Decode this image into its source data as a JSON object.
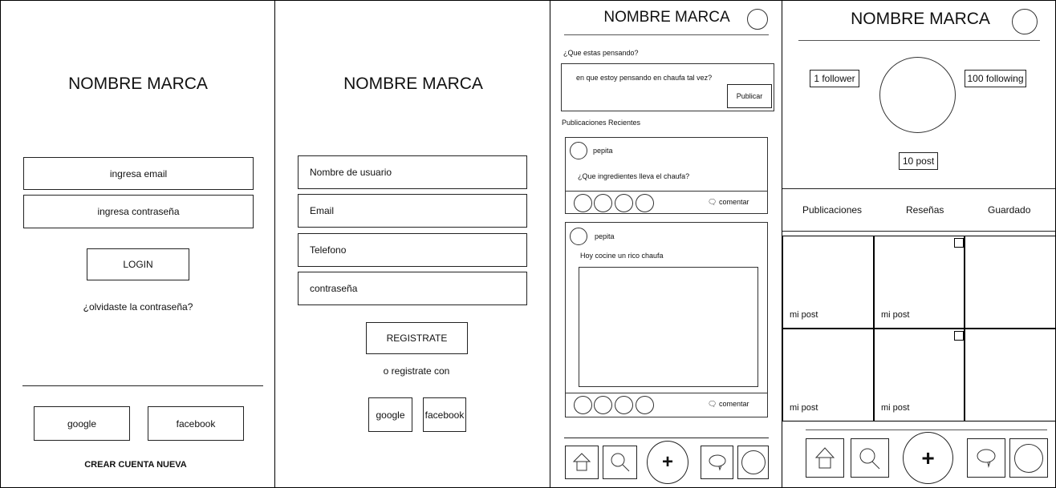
{
  "brand": "NOMBRE MARCA",
  "login": {
    "email_placeholder": "ingresa email",
    "password_placeholder": "ingresa contraseña",
    "login_button": "LOGIN",
    "forgot": "¿olvidaste la contraseña?",
    "google": "google",
    "facebook": "facebook",
    "create_account": "CREAR CUENTA NUEVA"
  },
  "register": {
    "fields": [
      "Nombre de usuario",
      "Email",
      "Telefono",
      "contraseña"
    ],
    "register_button": "REGISTRATE",
    "or_register_with": "o registrate con",
    "google": "google",
    "facebook": "facebook"
  },
  "feed": {
    "prompt_label": "¿Que estas pensando?",
    "prompt_value": "en que estoy pensando en chaufa tal vez?",
    "publish_button": "Publicar",
    "recent_label": "Publicaciones Recientes",
    "posts": [
      {
        "user": "pepita",
        "text": "¿Que ingredientes lleva el chaufa?",
        "comment": "comentar"
      },
      {
        "user": "pepita",
        "text": "Hoy cocine un rico chaufa",
        "comment": "comentar"
      }
    ]
  },
  "profile": {
    "followers": "1 follower",
    "following": "100 following",
    "posts": "10 post",
    "tabs": [
      "Publicaciones",
      "Reseñas",
      "Guardado"
    ],
    "grid_label": "mi post"
  },
  "nav_icons": [
    "home-icon",
    "search-icon",
    "plus-icon",
    "chat-icon",
    "profile-icon"
  ]
}
